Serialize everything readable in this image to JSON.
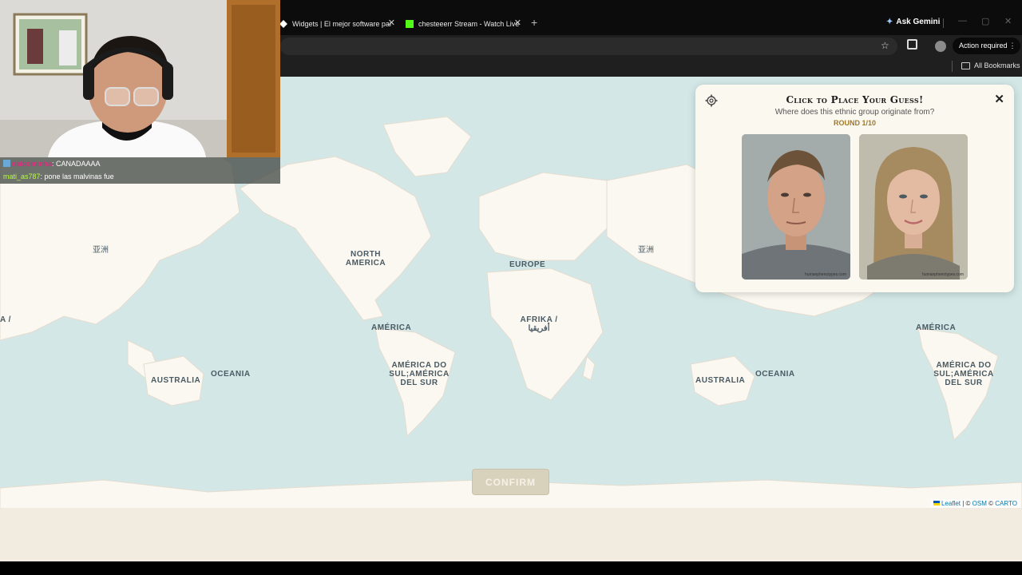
{
  "browser": {
    "tabs": [
      {
        "title": "Widgets | El mejor software par",
        "close": "✕"
      },
      {
        "title": "chesteeerr Stream - Watch Live",
        "close": "✕"
      }
    ],
    "new_tab": "+",
    "gemini_label": "Ask Gemini",
    "action_label": "Action required",
    "bookmarks_label": "All Bookmarks",
    "star_icon": "star-icon",
    "extensions_icon": "puzzle-icon"
  },
  "map": {
    "labels": [
      "亚洲",
      "NORTH AMERICA",
      "EUROPE",
      "亚洲",
      "AMÉRICA",
      "AFRIKA / أفريقيا",
      "AMÉRICA",
      "AUSTRALIA",
      "OCEANIA",
      "AMÉRICA DO SUL;AMÉRICA DEL SUR",
      "AUSTRALIA",
      "OCEANIA",
      "AMÉRICA DO SUL;AMÉRICA DEL SUR",
      "A /"
    ],
    "attribution": {
      "leaflet": "Leaflet",
      "osm": "OSM",
      "carto": "CARTO"
    },
    "confirm_label": "CONFIRM",
    "colors": {
      "water": "#d3e7e7",
      "land": "#fbf8f1",
      "border": "#e4dccf"
    }
  },
  "popup": {
    "title": "Click to Place Your Guess!",
    "subtitle": "Where does this ethnic group originate from?",
    "round": "ROUND 1/10",
    "close": "✕",
    "faces": [
      {
        "gender": "male",
        "source": "humanphenotypes.com"
      },
      {
        "gender": "female",
        "source": "humanphenotypes.com"
      }
    ]
  },
  "stream_overlay": {
    "chat": [
      {
        "user": "naicommha",
        "message": ": CANADAAAA"
      },
      {
        "user": "mati_as787",
        "message": ": pone las malvinas fue"
      }
    ]
  }
}
